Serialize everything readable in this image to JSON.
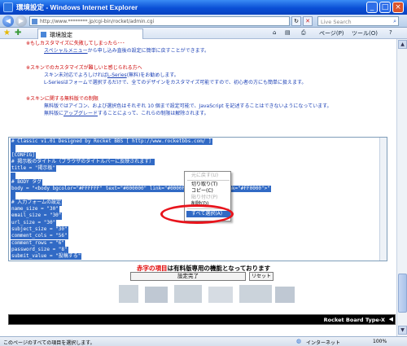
{
  "window": {
    "title": "環境設定 - Windows Internet Explorer",
    "minimize": "_",
    "maximize": "□",
    "close": "×"
  },
  "address": {
    "url": "http://www.********.jp/cgi-bin/rocket/admin.cgi",
    "search_placeholder": "Live Search"
  },
  "tab": {
    "label": "環境設定"
  },
  "commands": {
    "page": "ページ(P)",
    "tools": "ツール(O)"
  },
  "page": {
    "notes": [
      {
        "text": "※もしカスタマイズに失敗してしまったら･･･",
        "style": "red"
      },
      {
        "pre": "",
        "link": "スペシャルメニュー",
        "post": "から申し込み直後の設定に簡単に戻すことができます。",
        "style": "blue"
      },
      {
        "text": "※スキンでのカスタマイズが難しいと感じられる方へ",
        "style": "red"
      },
      {
        "pre": "スキン未対応でよろしければ",
        "link": "L-Series",
        "post": "(無料)をお勧めします。",
        "style": "blue"
      },
      {
        "text": "L-Seriesはフォームで選択するだけで、全てのデザインをカスタマイズ可能ですので、初心者の方にも簡単に扱えます。",
        "style": "blue"
      },
      {
        "text": "※スキンに関する無料版での制限",
        "style": "red"
      },
      {
        "text": "無料版ではアイコン、および選択色はそれぞれ 10 個まで設定可能で、JavaScript を記述することはできないようになっています。",
        "style": "blue"
      },
      {
        "pre": "無料版に",
        "link": "アップグレード",
        "post": "することによって、これらの制限は解除されます。",
        "style": "blue"
      }
    ],
    "config_lines": [
      "# Classic v1.01 Designed by Rocket BBS [ http://www.rocketbbs.com/ ]",
      "",
      "[CONFIG]",
      "# 掲示板のタイトル（ブラウザのタイトルバーに反映されます）",
      "title = \"掲示板\"",
      "",
      "# BODY タグ",
      "body = \"<body bgcolor=\"#FFFFFF\" text=\"#000000\" link=\"#0000FF\"          alink=\"#FF0000\">\"",
      "",
      "# 入力フォームの設定",
      "name_size = \"30\"",
      "email_size = \"30\"",
      "url_size = \"30\"",
      "subject_size = \"30\"",
      "comment_cols = \"56\"",
      "comment_rows = \"6\"",
      "password_size = \"8\"",
      "submit_value = \"投稿する\""
    ],
    "context_menu": {
      "undo": "元に戻す(U)",
      "cut": "切り取り(T)",
      "copy": "コピー(C)",
      "paste": "貼り付け(P)",
      "delete": "削除(D)",
      "select_all": "すべて選択(A)"
    },
    "free_note": {
      "red": "赤字の項目",
      "rest": "は有料版専用の機能となっております"
    },
    "submit_label": "設定完了",
    "reset_label": "リセット",
    "footer_brand": "Rocket Board Type-X"
  },
  "status": {
    "text": "このページのすべての項目を選択します。",
    "zone": "インターネット",
    "zoom": "100%"
  },
  "colors": {
    "selection": "#316ac5",
    "highlight_ring": "#e8141c",
    "note_red": "#cc0000",
    "note_blue": "#1a3fb5"
  }
}
